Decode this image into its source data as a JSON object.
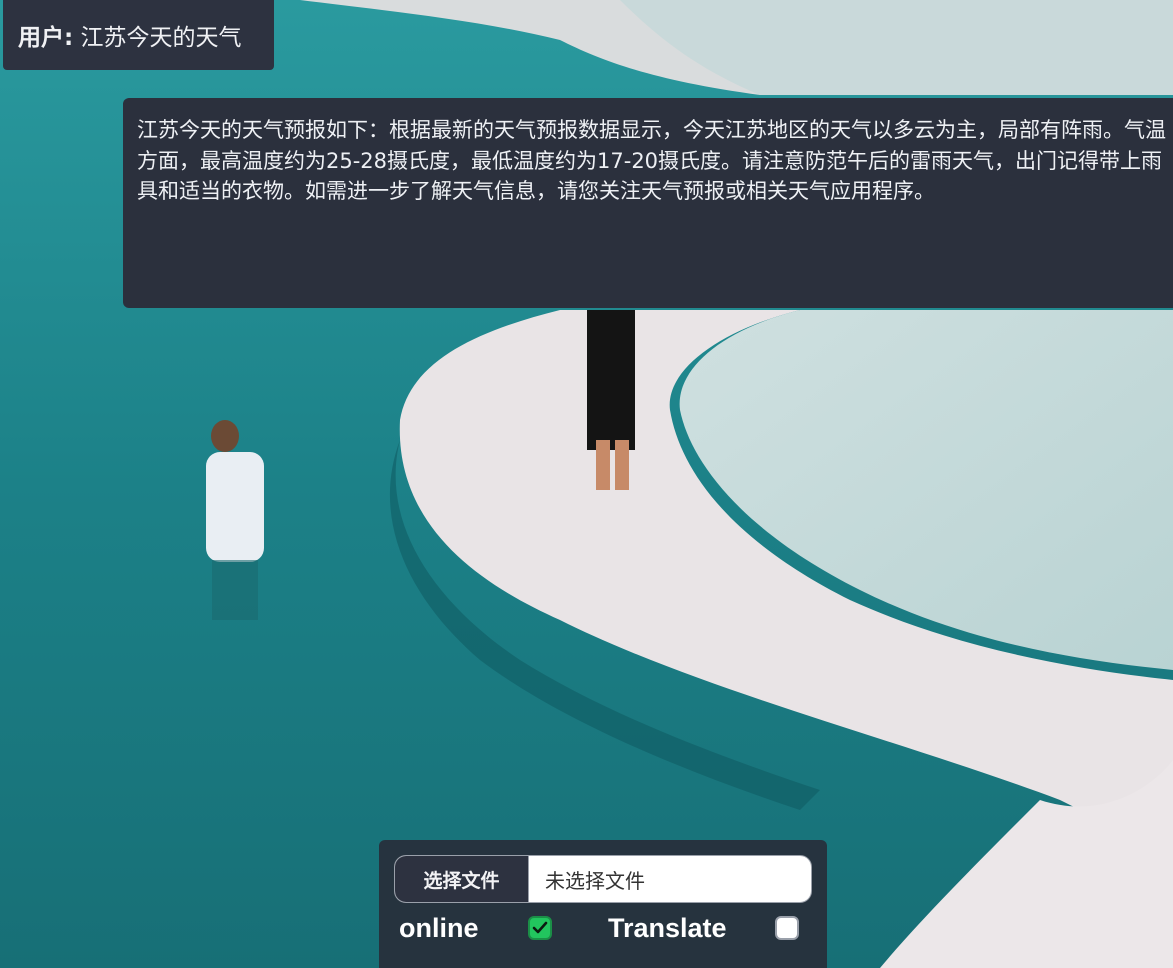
{
  "chat": {
    "user": {
      "speaker": "用户:",
      "text": "江苏今天的天气"
    },
    "bot": {
      "text": "江苏今天的天气预报如下：根据最新的天气预报数据显示，今天江苏地区的天气以多云为主，局部有阵雨。气温方面，最高温度约为25-28摄氏度，最低温度约为17-20摄氏度。请注意防范午后的雷雨天气，出门记得带上雨具和适当的衣物。如需进一步了解天气信息，请您关注天气预报或相关天气应用程序。"
    }
  },
  "controls": {
    "file_button_label": "选择文件",
    "file_status": "未选择文件",
    "online_label": "online",
    "online_checked": true,
    "translate_label": "Translate",
    "translate_checked": false
  },
  "colors": {
    "bubble_bg": "#2b303d",
    "checkbox_on": "#22c55e",
    "water": "#1f7f86",
    "salt": "#e9e4e6"
  },
  "icons": {
    "online_check": "check-icon"
  }
}
